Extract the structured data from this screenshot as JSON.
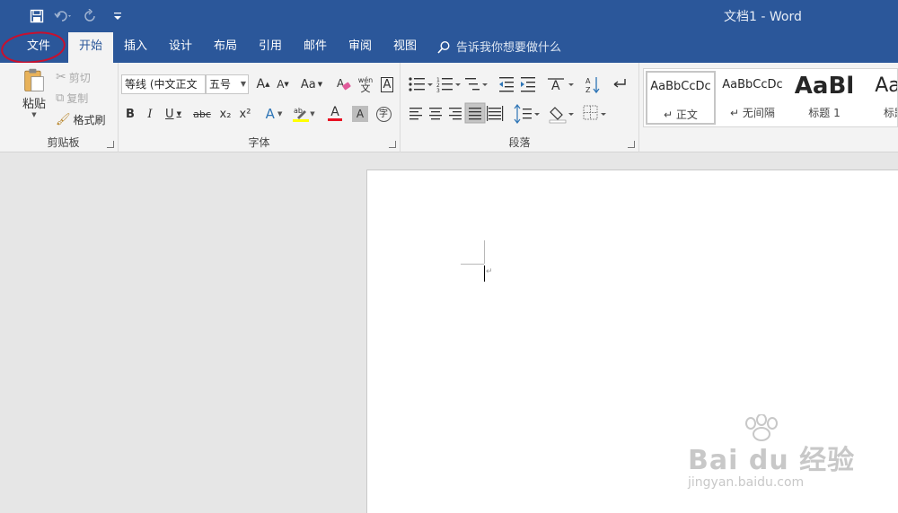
{
  "window": {
    "title": "文档1 - Word"
  },
  "qat": {
    "save_icon": "save-icon",
    "undo_icon": "undo-icon",
    "redo_icon": "redo-icon",
    "customize_icon": "customize-icon"
  },
  "tabs": [
    {
      "label": "文件"
    },
    {
      "label": "开始"
    },
    {
      "label": "插入"
    },
    {
      "label": "设计"
    },
    {
      "label": "布局"
    },
    {
      "label": "引用"
    },
    {
      "label": "邮件"
    },
    {
      "label": "审阅"
    },
    {
      "label": "视图"
    }
  ],
  "active_tab": "开始",
  "tell_me": {
    "placeholder": "告诉我你想要做什么"
  },
  "clipboard": {
    "group_label": "剪贴板",
    "paste": "粘贴",
    "cut": "剪切",
    "copy": "复制",
    "format_painter": "格式刷"
  },
  "font": {
    "group_label": "字体",
    "family_value": "等线 (中文正文",
    "size_value": "五号",
    "grow": "A",
    "shrink": "A",
    "case": "Aa",
    "bold": "B",
    "italic": "I",
    "underline": "U",
    "strikethrough": "abc",
    "subscript": "x₂",
    "superscript": "x²",
    "text_effects": "A",
    "font_color_letter": "A",
    "char_shading": "A",
    "char_border": "A",
    "phonetic_top": "wén",
    "phonetic_bottom": "文",
    "enclose": "字"
  },
  "paragraph": {
    "group_label": "段落"
  },
  "styles": {
    "items": [
      {
        "sample": "AaBbCcDc",
        "name": "正文"
      },
      {
        "sample": "AaBbCcDc",
        "name": "无间隔"
      },
      {
        "sample": "AaBl",
        "name": "标题 1"
      },
      {
        "sample": "AaB",
        "name": "标题"
      }
    ]
  },
  "watermark": {
    "main": "Bai du 经验",
    "sub": "jingyan.baidu.com"
  },
  "colors": {
    "brand": "#2b579a",
    "annotation": "#c8102e",
    "font_color": "#e81123",
    "highlight": "#ffff00"
  }
}
